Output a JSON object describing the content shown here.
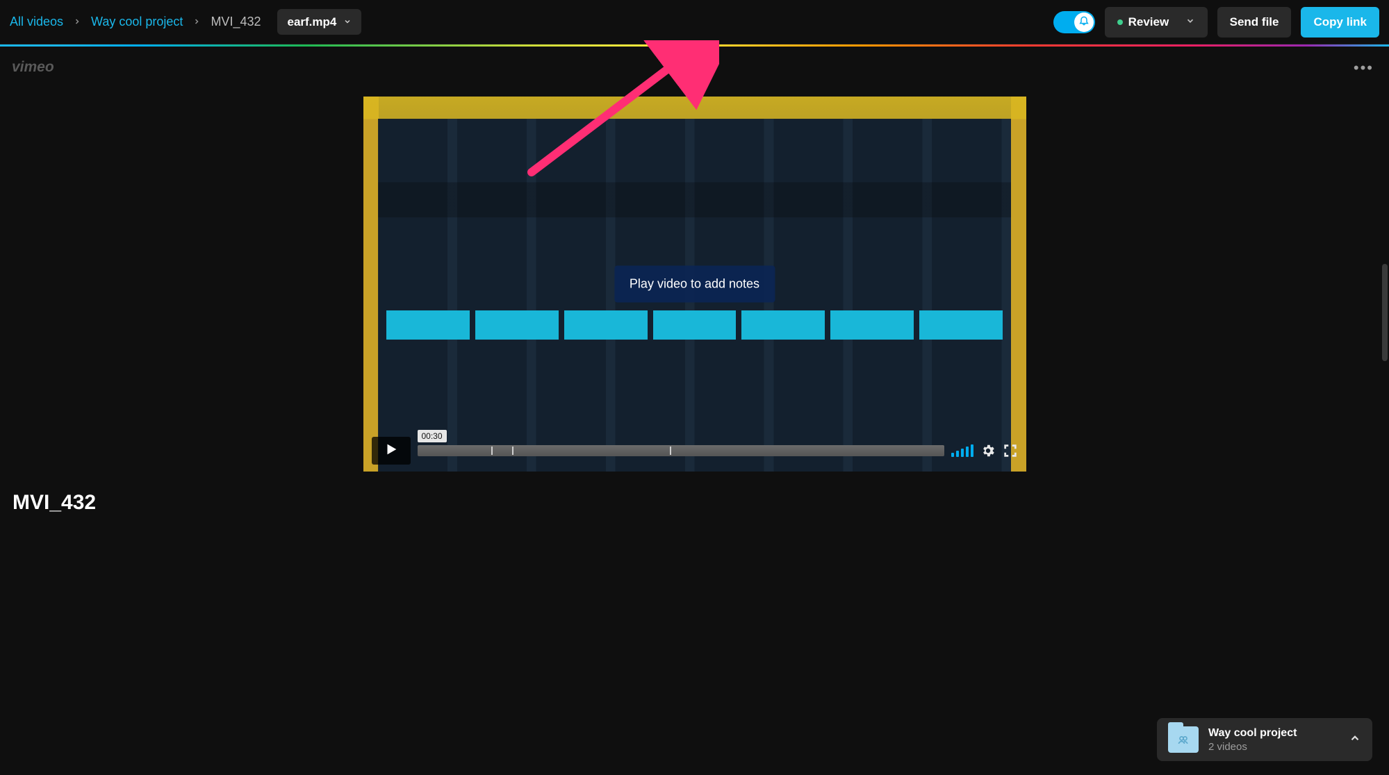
{
  "breadcrumbs": {
    "root": "All videos",
    "project": "Way cool project",
    "item": "MVI_432"
  },
  "file_chip": {
    "label": "earf.mp4"
  },
  "toolbar": {
    "review_label": "Review",
    "send_file": "Send file",
    "copy_link": "Copy link"
  },
  "player": {
    "overlay_text": "Play video to add notes",
    "time": "00:30"
  },
  "title": "MVI_432",
  "toast": {
    "title": "Way cool project",
    "subtitle": "2 videos"
  }
}
